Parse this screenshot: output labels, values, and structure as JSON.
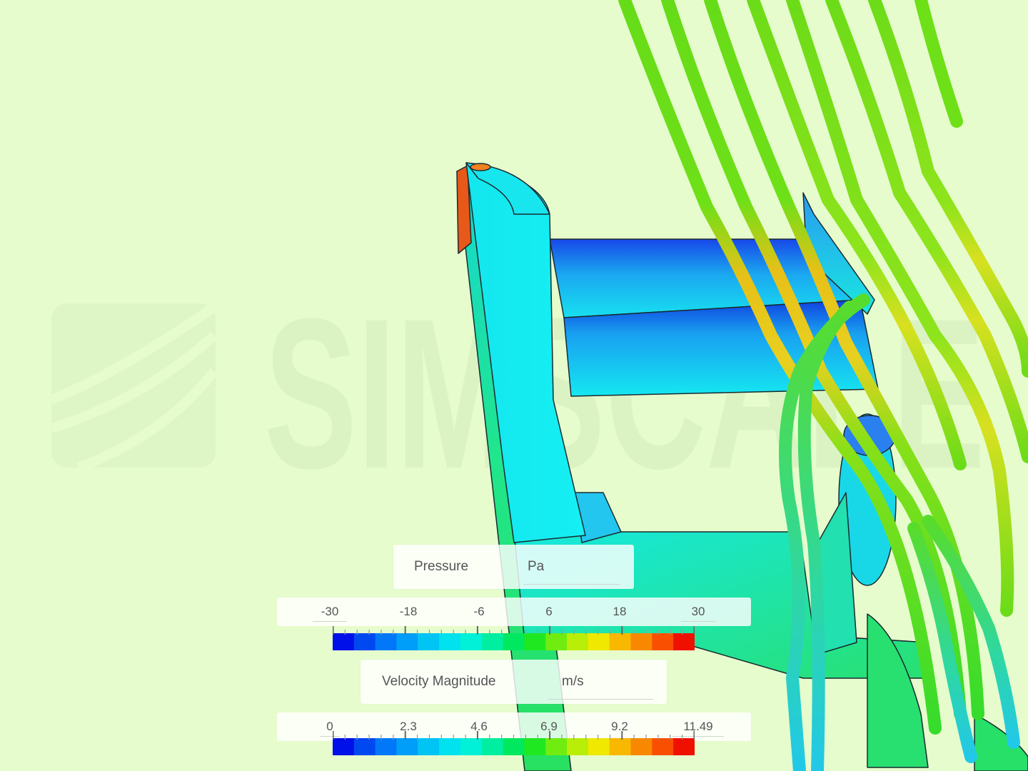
{
  "viewer": {
    "watermark_text": "SIMSCALE",
    "background_color": "#e6fccc"
  },
  "legends": [
    {
      "quantity": "Pressure",
      "unit": "Pa",
      "ticks": [
        "-30",
        "-18",
        "-6",
        "6",
        "18",
        "30"
      ],
      "colors": [
        "#0010e8",
        "#0048f0",
        "#0078f8",
        "#009ef8",
        "#00c4f4",
        "#00e2ee",
        "#00f0d8",
        "#00eea0",
        "#00e860",
        "#20e820",
        "#70ec10",
        "#b8ee08",
        "#f0e800",
        "#f8b800",
        "#f88800",
        "#f85000",
        "#f01000"
      ]
    },
    {
      "quantity": "Velocity Magnitude",
      "unit": "m/s",
      "ticks": [
        "0",
        "2.3",
        "4.6",
        "6.9",
        "9.2",
        "11.49"
      ],
      "colors": [
        "#0010e8",
        "#0048f0",
        "#0078f8",
        "#009ef8",
        "#00c4f4",
        "#00e2ee",
        "#00f0d8",
        "#00eea0",
        "#00e860",
        "#20e820",
        "#70ec10",
        "#b8ee08",
        "#f0e800",
        "#f8b800",
        "#f88800",
        "#f85000",
        "#f01000"
      ]
    }
  ],
  "colors": {
    "surface_cyan": "#14eef0",
    "surface_green": "#2ee86c",
    "surface_blue": "#1e6ef0",
    "streamline_green": "#6cdc1c",
    "streamline_yellow": "#e8d81c"
  }
}
